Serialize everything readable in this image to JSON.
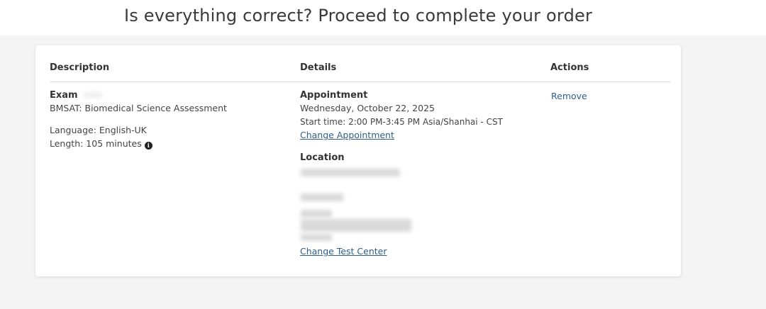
{
  "page": {
    "title": "Is everything correct? Proceed to complete your order"
  },
  "table": {
    "headers": {
      "description": "Description",
      "details": "Details",
      "actions": "Actions"
    },
    "row": {
      "exam_label": "Exam",
      "exam_name": "BMSAT: Biomedical Science Assessment",
      "language": "Language: English-UK",
      "length": "Length: 105 minutes",
      "appointment_label": "Appointment",
      "appointment_date": "Wednesday, October 22, 2025",
      "start_time": "Start time: 2:00 PM-3:45 PM Asia/Shanhai - CST",
      "change_appointment": "Change Appointment",
      "location_label": "Location",
      "change_test_center": "Change Test Center",
      "remove_label": "Remove"
    }
  },
  "icons": {
    "length_info": "info-icon"
  }
}
